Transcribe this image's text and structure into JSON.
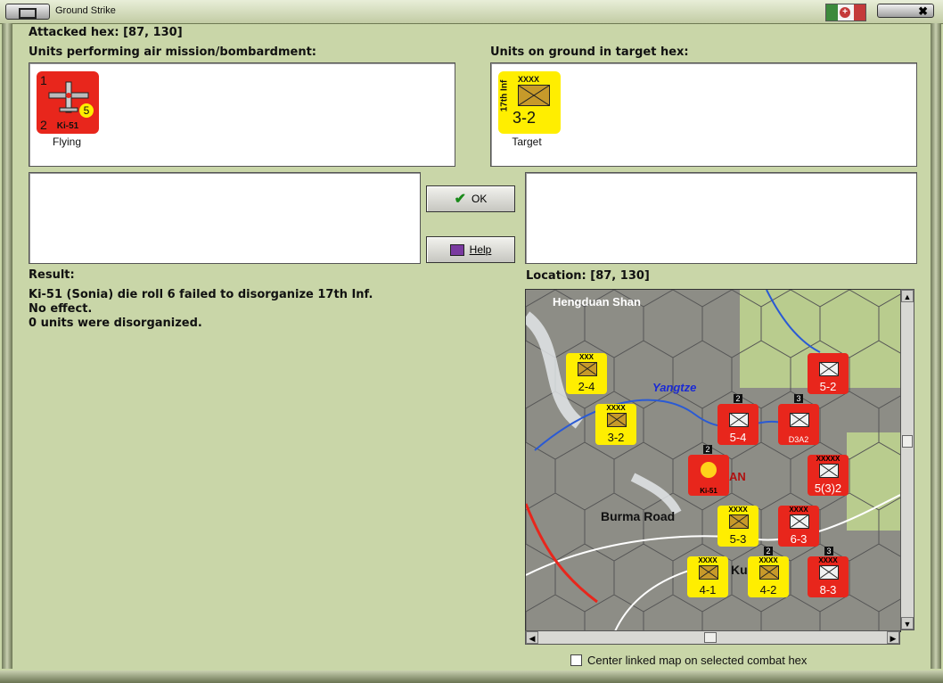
{
  "window": {
    "title": "Ground Strike",
    "close_glyph": "✖"
  },
  "attacked_hex": "Attacked hex:  [87, 130]",
  "left_panel_label": "Units performing air mission/bombardment:",
  "right_panel_label": "Units on ground in target hex:",
  "air_unit": {
    "name": "Ki-51",
    "badge": "5",
    "corner_tl": "1",
    "corner_bl": "2",
    "caption": "Flying"
  },
  "ground_unit": {
    "name": "17th Inf",
    "size": "XXXX",
    "strength": "3-2",
    "caption": "Target"
  },
  "buttons": {
    "ok": "OK",
    "help": "Help"
  },
  "result": {
    "label": "Result:",
    "lines": [
      "Ki-51 (Sonia) die roll 6 failed to disorganize 17th Inf.",
      "No effect.",
      "0 units were disorganized."
    ]
  },
  "location": "Location:  [87, 130]",
  "map": {
    "labels": {
      "hengduan": "Hengduan Shan",
      "yangtze": "Yangtze",
      "burma_road": "Burma Road",
      "ku": "Ku",
      "an": "AN"
    },
    "units": [
      {
        "color": "y",
        "size": "XXX",
        "strength": "2-4"
      },
      {
        "color": "y",
        "size": "XXXX",
        "strength": "3-2"
      },
      {
        "color": "r",
        "size": "",
        "strength": "5-4"
      },
      {
        "color": "r",
        "size": "",
        "strength": "5-2"
      },
      {
        "color": "r",
        "size": "",
        "strength": "D3A2"
      },
      {
        "color": "r",
        "size": "XXXXX",
        "strength": "5(3)2"
      },
      {
        "color": "r",
        "size": "Ki-51",
        "strength": ""
      },
      {
        "color": "y",
        "size": "XXXX",
        "strength": "5-3"
      },
      {
        "color": "r",
        "size": "XXXX",
        "strength": "6-3"
      },
      {
        "color": "y",
        "size": "XXXX",
        "strength": "4-1"
      },
      {
        "color": "y",
        "size": "XXXX",
        "strength": "4-2"
      },
      {
        "color": "r",
        "size": "XXXX",
        "strength": "8-3"
      }
    ],
    "stack_counts": [
      "2",
      "3",
      "2",
      "2",
      "3"
    ]
  },
  "center_map_checkbox": "Center linked map on selected combat hex",
  "colors": {
    "background": "#c9d6a8",
    "axis_red": "#e8261c",
    "allied_yellow": "#ffee00"
  }
}
